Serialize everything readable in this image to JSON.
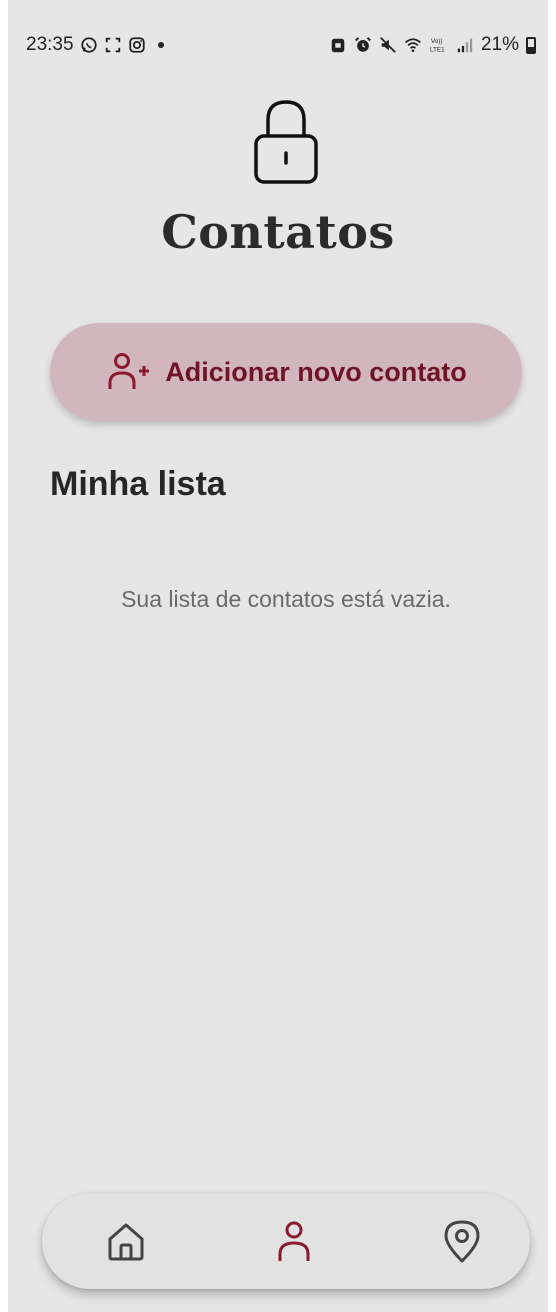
{
  "status_bar": {
    "time": "23:35",
    "battery": "21%",
    "left_icons": [
      "whatsapp-icon",
      "screenshot-icon",
      "instagram-icon",
      "notification-dot"
    ],
    "right_icons": [
      "lock-badge-icon",
      "alarm-icon",
      "mute-icon",
      "wifi-icon",
      "volte-icon",
      "signal-icon",
      "battery-icon"
    ]
  },
  "header": {
    "icon": "lock-icon",
    "title": "Contatos"
  },
  "actions": {
    "add_contact_label": "Adicionar novo contato",
    "add_contact_icon": "person-add-icon"
  },
  "list": {
    "title": "Minha lista",
    "empty_message": "Sua lista de contatos está vazia.",
    "items": []
  },
  "bottom_nav": {
    "items": [
      {
        "name": "home",
        "icon": "home-icon",
        "active": false
      },
      {
        "name": "contacts",
        "icon": "person-icon",
        "active": true
      },
      {
        "name": "location",
        "icon": "location-pin-icon",
        "active": false
      }
    ]
  },
  "colors": {
    "background": "#e6e6e6",
    "accent": "#8b1a2f",
    "button_bg": "#d2b6be",
    "button_text": "#6e1426",
    "nav_bg": "#e2e2e2",
    "icon_inactive": "#444444"
  }
}
